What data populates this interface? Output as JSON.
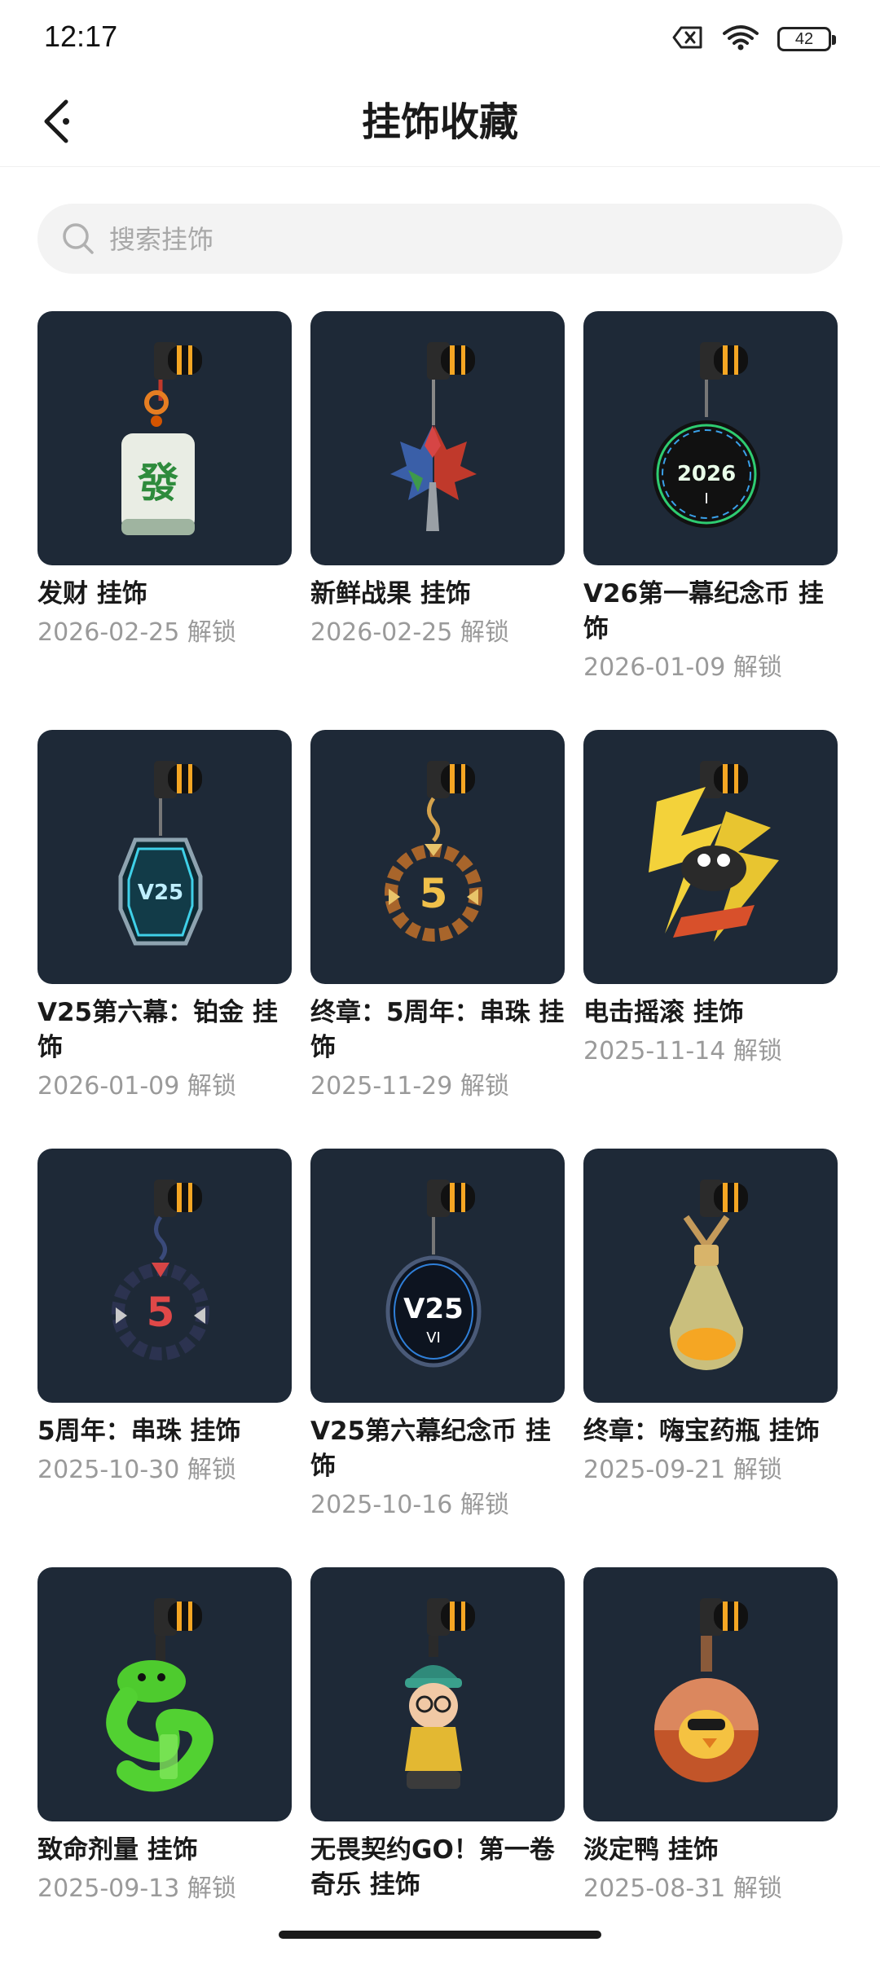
{
  "status_bar": {
    "time": "12:17",
    "battery": "42"
  },
  "header": {
    "title": "挂饰收藏"
  },
  "search": {
    "placeholder": "搜索挂饰"
  },
  "colors": {
    "thumb_bg": "#1e2937",
    "clip_orange": "#f5a623"
  },
  "items": [
    {
      "name": "发财 挂饰",
      "date": "2026-02-25 解锁",
      "icon": "mahjong-charm-icon"
    },
    {
      "name": "新鲜战果 挂饰",
      "date": "2026-02-25 解锁",
      "icon": "maple-leaf-charm-icon"
    },
    {
      "name": "V26第一幕纪念币 挂饰",
      "date": "2026-01-09 解锁",
      "icon": "coin-2026-charm-icon",
      "coin_text": "2026",
      "coin_sub": "I"
    },
    {
      "name": "V25第六幕：铂金 挂饰",
      "date": "2026-01-09 解锁",
      "icon": "platinum-badge-charm-icon",
      "badge_text": "V25"
    },
    {
      "name": "终章：5周年：串珠 挂饰",
      "date": "2025-11-29 解锁",
      "icon": "gold-bead-charm-icon",
      "bead_text": "5"
    },
    {
      "name": "电击摇滚 挂饰",
      "date": "2025-11-14 解锁",
      "icon": "lightning-charm-icon"
    },
    {
      "name": "5周年：串珠 挂饰",
      "date": "2025-10-30 解锁",
      "icon": "dark-bead-charm-icon",
      "bead_text": "5"
    },
    {
      "name": "V25第六幕纪念币 挂饰",
      "date": "2025-10-16 解锁",
      "icon": "coin-v25-charm-icon",
      "coin_text": "V25",
      "coin_sub": "VI"
    },
    {
      "name": "终章：嗨宝药瓶 挂饰",
      "date": "2025-09-21 解锁",
      "icon": "potion-bottle-charm-icon"
    },
    {
      "name": "致命剂量 挂饰",
      "date": "2025-09-13 解锁",
      "icon": "green-snake-charm-icon"
    },
    {
      "name": "无畏契约GO！第一卷 奇乐 挂饰",
      "date": "",
      "icon": "killjoy-figure-charm-icon"
    },
    {
      "name": "淡定鸭 挂饰",
      "date": "2025-08-31 解锁",
      "icon": "duck-capsule-charm-icon"
    }
  ]
}
